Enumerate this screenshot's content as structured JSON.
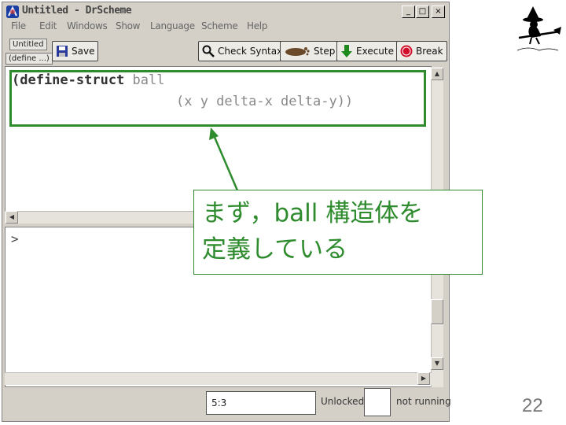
{
  "window": {
    "title": "Untitled - DrScheme",
    "controls": [
      "_",
      "□",
      "×"
    ]
  },
  "menubar": [
    "File",
    "Edit",
    "Windows",
    "Show",
    "Language",
    "Scheme",
    "Help"
  ],
  "toolbar": {
    "file_chip": "Untitled",
    "define_chip": "(define ...)",
    "save_label": "Save",
    "check_syntax_label": "Check Syntax",
    "step_label": "Step",
    "execute_label": "Execute",
    "break_label": "Break"
  },
  "definitions": {
    "line1_keyword": "(define-struct",
    "line1_rest": " ball",
    "line2": "(x y delta-x delta-y))"
  },
  "interactions": {
    "prompt": ">"
  },
  "status": {
    "position": "5:3",
    "lock": "Unlocked",
    "running": "not running"
  },
  "callout": {
    "line1": "まず，ball 構造体を",
    "line2": "定義している"
  },
  "slide": {
    "page_number": "22"
  },
  "colors": {
    "accent_green": "#2e8b2e",
    "window_gray": "#d4d0c8"
  }
}
